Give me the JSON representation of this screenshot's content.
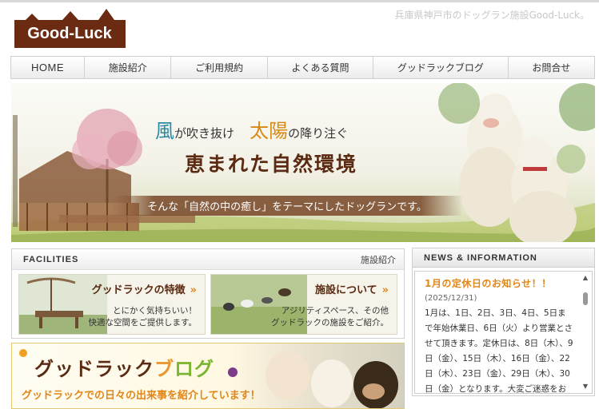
{
  "header": {
    "logo_text": "Good-Luck",
    "tagline": "兵庫県神戸市のドッグラン施設Good-Luck。"
  },
  "nav": {
    "items": [
      {
        "label": "HOME"
      },
      {
        "label": "施設紹介"
      },
      {
        "label": "ご利用規約"
      },
      {
        "label": "よくある質問"
      },
      {
        "label": "グッドラックブログ"
      },
      {
        "label": "お問合せ"
      }
    ]
  },
  "hero": {
    "kaze": "風",
    "line1_a": "が吹き抜け",
    "taiyo": "太陽",
    "line1_b": "の降り注ぐ",
    "line2": "恵まれた自然環境",
    "band": "そんな「自然の中の癒し」をテーマにしたドッグランです。"
  },
  "facilities": {
    "title": "FACILITIES",
    "subtitle": "施設紹介",
    "cards": [
      {
        "title": "グッドラックの特徴",
        "arrow": "»",
        "desc": [
          "とにかく気持ちいい！",
          "快適な空間をご提供します。"
        ]
      },
      {
        "title": "施設について",
        "arrow": "»",
        "desc": [
          "アジリティスペース、その他",
          "グッドラックの施設をご紹介。"
        ]
      }
    ]
  },
  "blog": {
    "title_a": "グッドラック",
    "title_b": "ブ",
    "title_c": "ログ",
    "desc": "グッドラックでの日々の出来事を紹介しています！"
  },
  "news": {
    "title": "NEWS & INFORMATION",
    "item": {
      "title": "1月の定休日のお知らせ！！",
      "date": "(2025/12/31)",
      "text": "1月は、1日、2日、3日、4日、5日まで年始休業日、6日（火）より営業とさせて頂きます。定休日は、8日（木）、9日（金）、15日（木）、16日（金）、22日（木）、23日（金）、29日（木）、30日（金）となります。大変ご迷惑をお掛け致しま"
    }
  },
  "colors": {
    "brand_brown": "#5a2b12",
    "accent_orange": "#e0861a",
    "kaze_blue": "#2a8aa3"
  }
}
